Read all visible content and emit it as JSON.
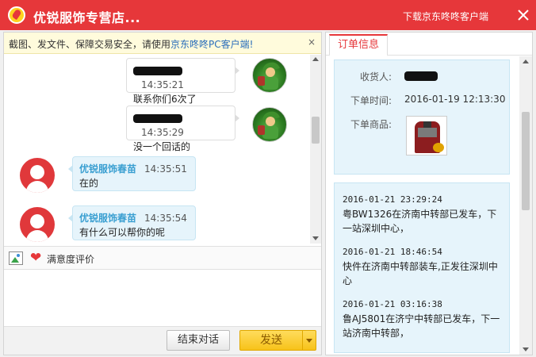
{
  "window": {
    "title": "优锐服饰专营店...",
    "download_link": "下载京东咚咚客户端",
    "accent_color": "#e6373a"
  },
  "notice": {
    "text": "截图、发文件、保障交易安全，请使用",
    "link_text": "京东咚咚PC客户端!",
    "close": "×"
  },
  "messages": [
    {
      "sender": "customer",
      "time": "14:35:21",
      "text": "联系你们6次了"
    },
    {
      "sender": "customer",
      "time": "14:35:29",
      "text": "没一个回话的"
    },
    {
      "sender": "agent",
      "name": "优锐服饰春苗",
      "time": "14:35:51",
      "text": "在的"
    },
    {
      "sender": "agent",
      "name": "优锐服饰春苗",
      "time": "14:35:54",
      "text": "有什么可以帮你的呢"
    }
  ],
  "toolbar": {
    "image_icon": "image-icon",
    "heart_icon": "heart-icon",
    "rating_label": "满意度评价"
  },
  "buttons": {
    "end_chat": "结束对话",
    "send": "发送"
  },
  "right_panel": {
    "tab_label": "订单信息",
    "order": {
      "recipient_label": "收货人:",
      "time_label": "下单时间:",
      "time_value": "2016-01-19 12:13:30",
      "product_label": "下单商品:"
    },
    "logistics": [
      {
        "time": "2016-01-21 23:29:24",
        "text": "粤BW1326在济南中转部已发车，下一站深圳中心，"
      },
      {
        "time": "2016-01-21 18:46:54",
        "text": "快件在济南中转部装车,正发往深圳中心"
      },
      {
        "time": "2016-01-21 03:16:38",
        "text": "鲁AJ5801在济宁中转部已发车，下一站济南中转部，"
      }
    ]
  }
}
